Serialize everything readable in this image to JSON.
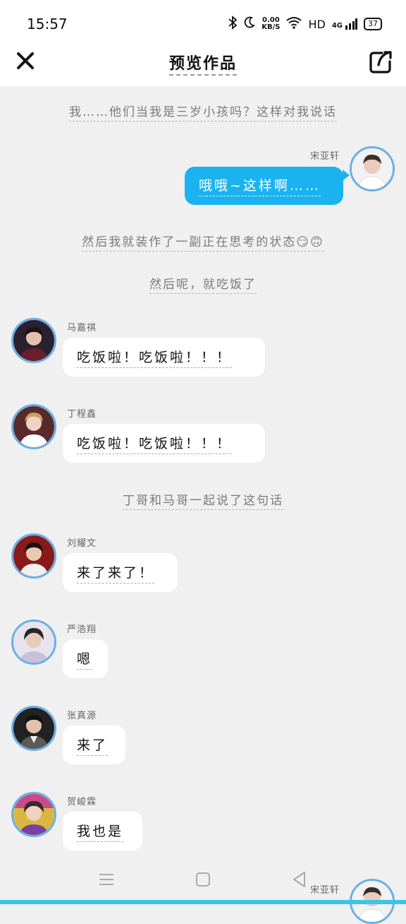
{
  "status_bar": {
    "time": "15:57",
    "net_speed_value": "0.00",
    "net_speed_unit": "KB/S",
    "hd": "HD",
    "signal_label": "4G",
    "battery": "37"
  },
  "header": {
    "title": "预览作品"
  },
  "messages": {
    "n1": "我……他们当我是三岁小孩吗？这样对我说话",
    "m1_name": "宋亚轩",
    "m1_text": "哦哦~这样啊……",
    "n2": "然后我就装作了一副正在思考的状态😏🙃",
    "n3": "然后呢，就吃饭了",
    "m2_name": "马嘉祺",
    "m2_text": "吃饭啦！吃饭啦！！！",
    "m3_name": "丁程鑫",
    "m3_text": "吃饭啦！吃饭啦！！！",
    "n4": "丁哥和马哥一起说了这句话",
    "m4_name": "刘耀文",
    "m4_text": "来了来了！",
    "m5_name": "严浩翔",
    "m5_text": "嗯",
    "m6_name": "张真源",
    "m6_text": "来了",
    "m7_name": "贺峻霖",
    "m7_text": "我也是",
    "m8_name": "宋亚轩"
  },
  "colors": {
    "background": "#f0f0f0",
    "right_bubble": "#1ab3f0",
    "avatar_ring": "#6aaee6",
    "bottom_strip": "#38c6e6"
  }
}
